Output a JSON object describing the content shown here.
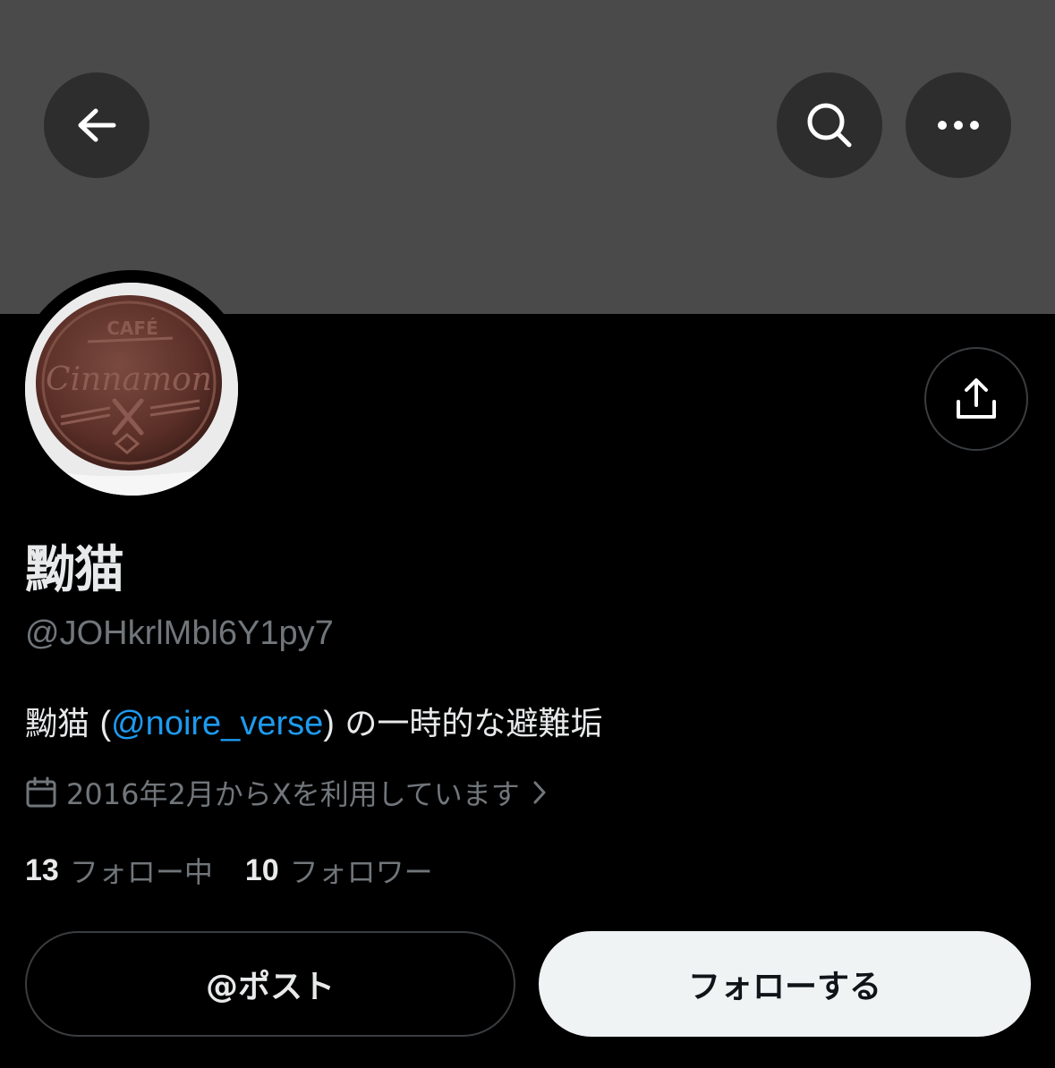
{
  "header": {
    "back_icon": "arrow-left-icon",
    "search_icon": "search-icon",
    "more_icon": "more-horizontal-icon",
    "banner_color": "#4a4a4a"
  },
  "profile": {
    "avatar_icon": "chocolate-coin-avatar",
    "avatar_logo_text": "Cinnamon",
    "display_name": "黝猫",
    "handle": "@JOHkrlMbl6Y1py7",
    "bio": {
      "prefix": "黝猫 ",
      "paren_open": "(",
      "mention": "@noire_verse",
      "paren_close": ")",
      "suffix": " の一時的な避難垢"
    },
    "joined": "2016年2月からXを利用しています",
    "following_count": "13",
    "following_label": "フォロー中",
    "followers_count": "10",
    "followers_label": "フォロワー"
  },
  "actions": {
    "share_icon": "share-icon",
    "post_label": "@ポスト",
    "follow_label": "フォローする"
  },
  "colors": {
    "background": "#000000",
    "mention": "#1d9bf0",
    "muted": "#71767b",
    "follow_button_bg": "#eff3f4"
  }
}
